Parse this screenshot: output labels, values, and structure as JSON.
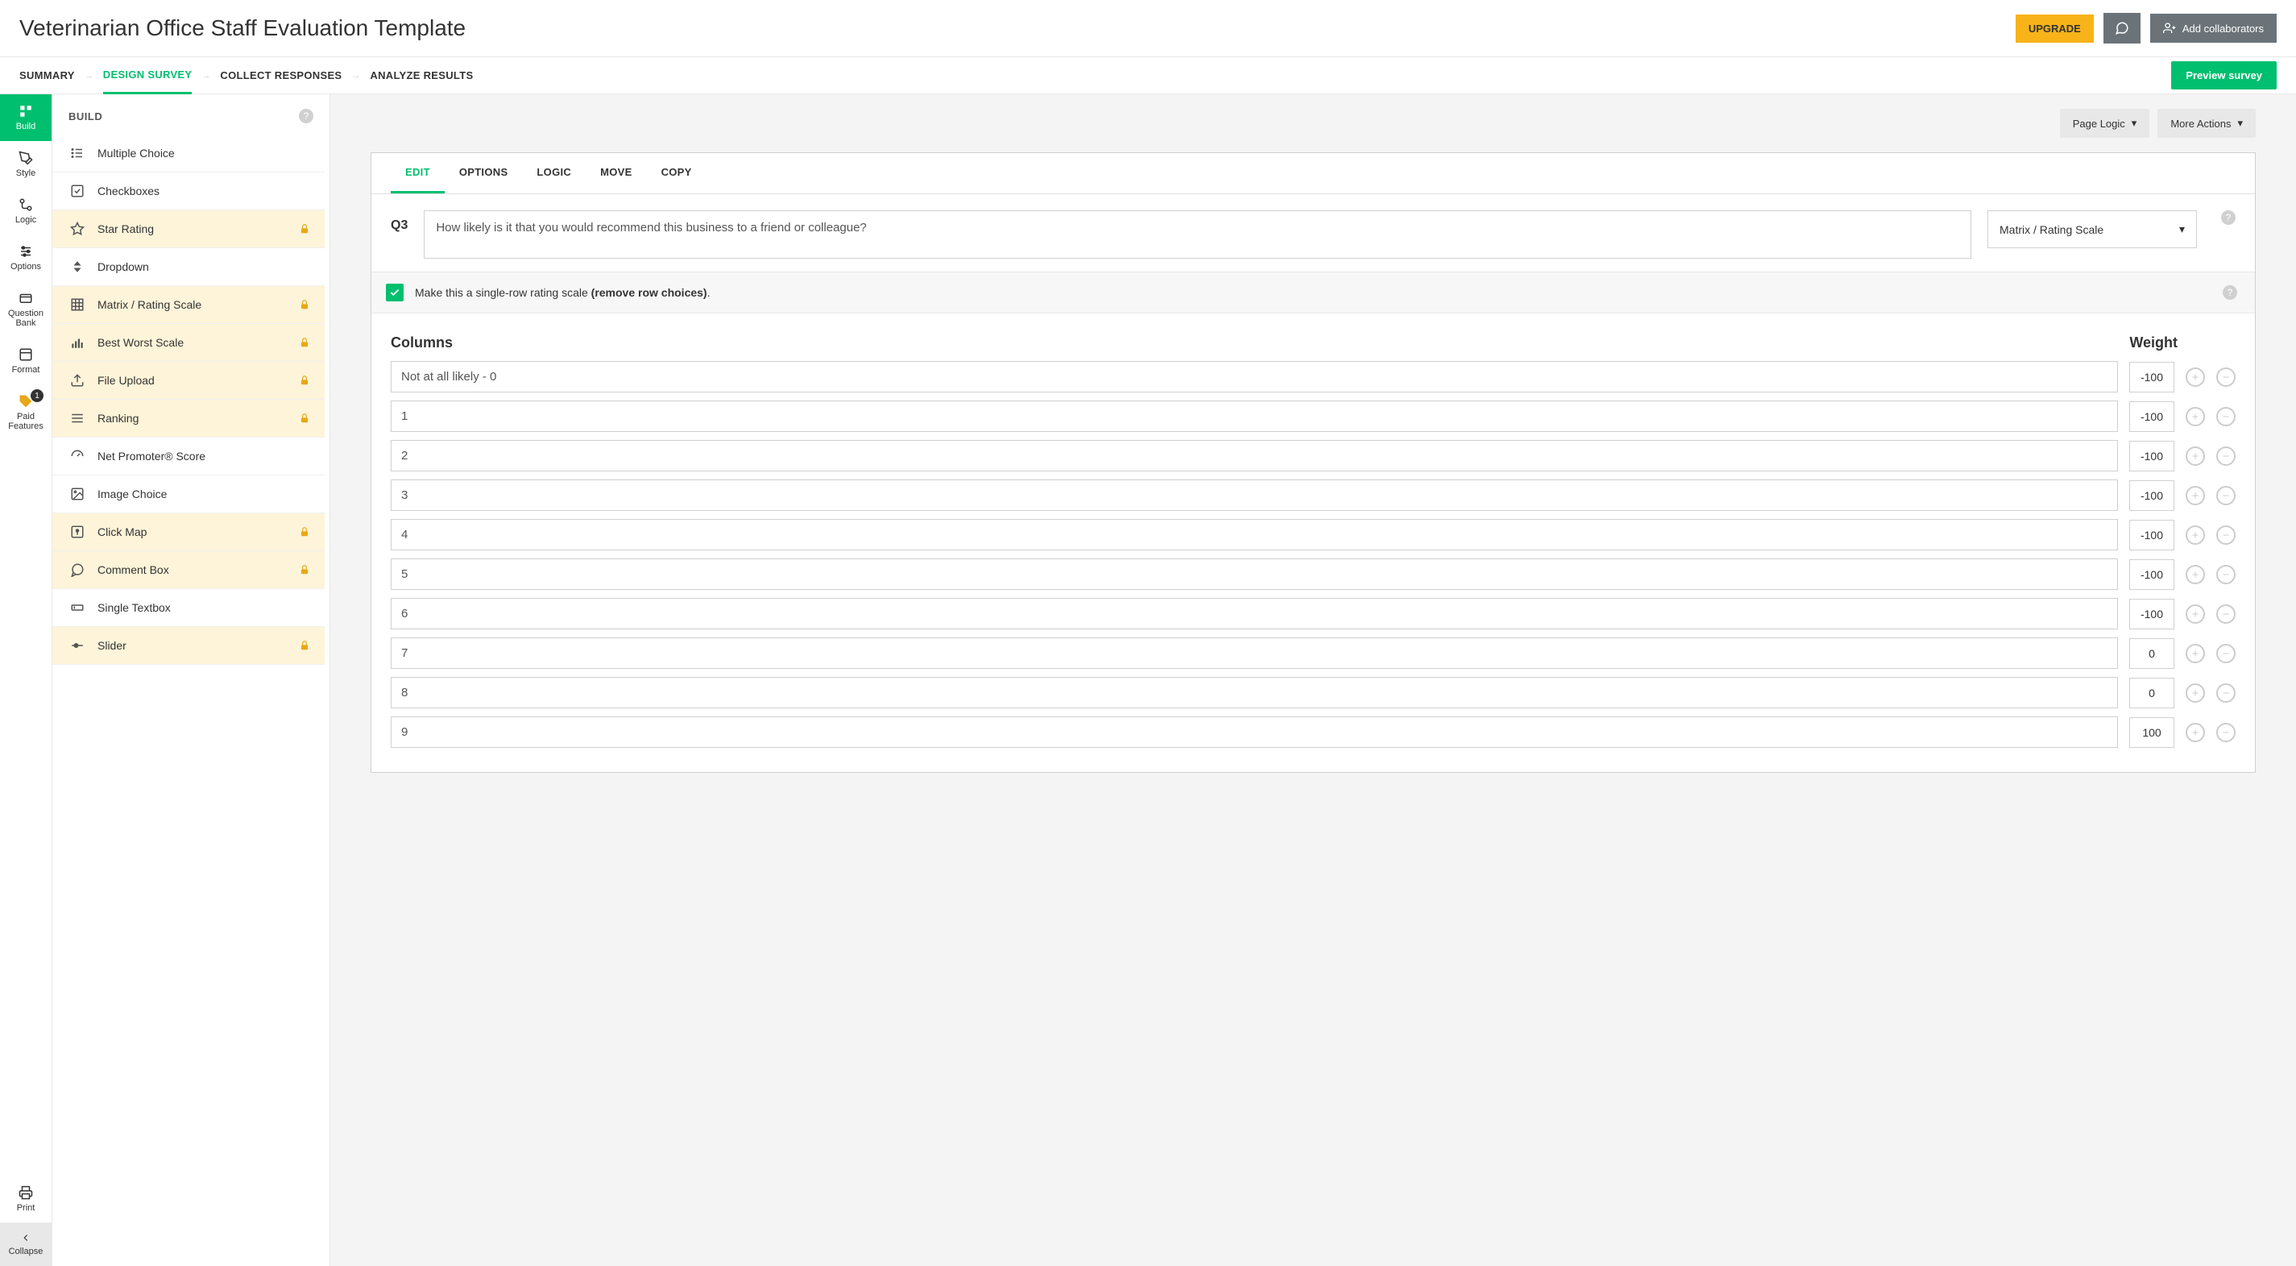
{
  "header": {
    "title": "Veterinarian Office Staff Evaluation Template",
    "upgrade": "UPGRADE",
    "add_collaborators": "Add collaborators"
  },
  "nav": {
    "summary": "SUMMARY",
    "design": "DESIGN SURVEY",
    "collect": "COLLECT RESPONSES",
    "analyze": "ANALYZE RESULTS",
    "preview": "Preview survey"
  },
  "rail": {
    "build": "Build",
    "style": "Style",
    "logic": "Logic",
    "options": "Options",
    "qbank": "Question\nBank",
    "format": "Format",
    "paid": "Paid\nFeatures",
    "paid_badge": "1",
    "print": "Print",
    "collapse": "Collapse"
  },
  "build": {
    "title": "BUILD",
    "types": [
      {
        "label": "Multiple Choice",
        "locked": false,
        "icon": "list"
      },
      {
        "label": "Checkboxes",
        "locked": false,
        "icon": "check"
      },
      {
        "label": "Star Rating",
        "locked": true,
        "icon": "star"
      },
      {
        "label": "Dropdown",
        "locked": false,
        "icon": "updown"
      },
      {
        "label": "Matrix / Rating Scale",
        "locked": true,
        "icon": "grid"
      },
      {
        "label": "Best Worst Scale",
        "locked": true,
        "icon": "bars"
      },
      {
        "label": "File Upload",
        "locked": true,
        "icon": "upload"
      },
      {
        "label": "Ranking",
        "locked": true,
        "icon": "lines"
      },
      {
        "label": "Net Promoter® Score",
        "locked": false,
        "icon": "gauge"
      },
      {
        "label": "Image Choice",
        "locked": false,
        "icon": "image"
      },
      {
        "label": "Click Map",
        "locked": true,
        "icon": "imgpin"
      },
      {
        "label": "Comment Box",
        "locked": true,
        "icon": "comment"
      },
      {
        "label": "Single Textbox",
        "locked": false,
        "icon": "textbox"
      },
      {
        "label": "Slider",
        "locked": true,
        "icon": "slider"
      }
    ]
  },
  "canvas": {
    "page_logic": "Page Logic",
    "more_actions": "More Actions"
  },
  "qeditor": {
    "tabs": {
      "edit": "EDIT",
      "options": "OPTIONS",
      "logic": "LOGIC",
      "move": "MOVE",
      "copy": "COPY"
    },
    "qnum": "Q3",
    "qtext": "How likely is it that you would recommend this business to a friend or colleague?",
    "qtype": "Matrix / Rating Scale",
    "checkbox_text_pre": "Make this a single-row rating scale ",
    "checkbox_text_bold": "(remove row choices)",
    "checkbox_text_post": ".",
    "columns_title": "Columns",
    "weight_title": "Weight",
    "columns": [
      {
        "label": "Not at all likely - 0",
        "weight": "-100"
      },
      {
        "label": "1",
        "weight": "-100"
      },
      {
        "label": "2",
        "weight": "-100"
      },
      {
        "label": "3",
        "weight": "-100"
      },
      {
        "label": "4",
        "weight": "-100"
      },
      {
        "label": "5",
        "weight": "-100"
      },
      {
        "label": "6",
        "weight": "-100"
      },
      {
        "label": "7",
        "weight": "0"
      },
      {
        "label": "8",
        "weight": "0"
      },
      {
        "label": "9",
        "weight": "100"
      }
    ]
  }
}
